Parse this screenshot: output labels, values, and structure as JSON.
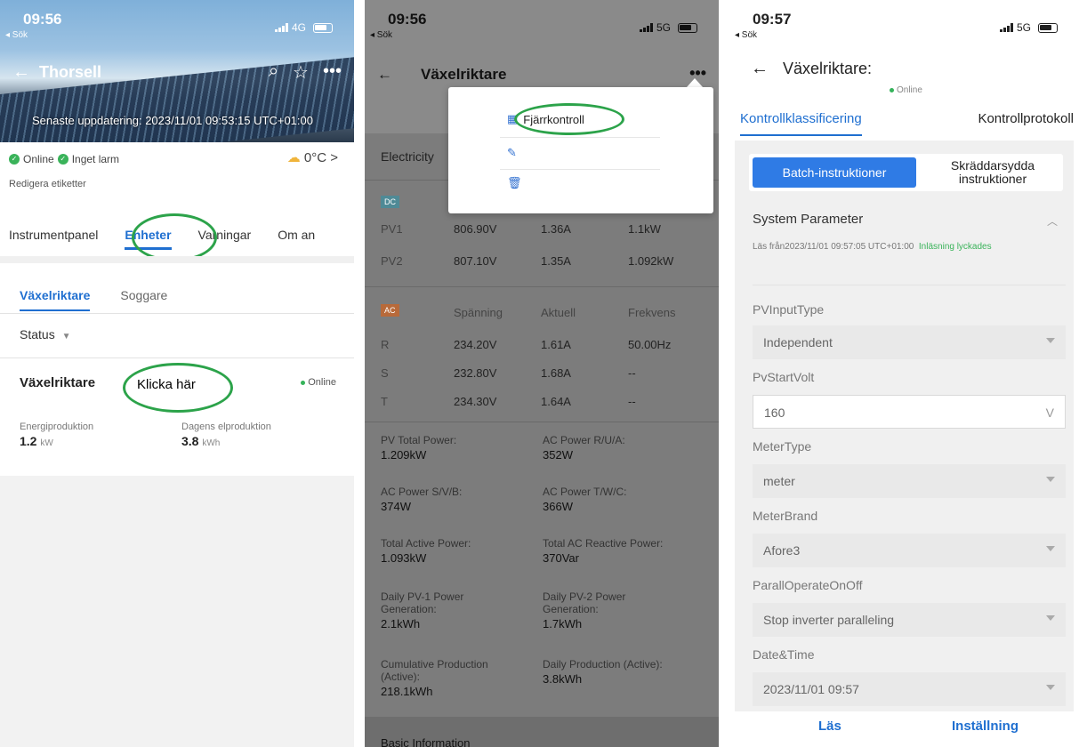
{
  "screen1": {
    "time": "09:56",
    "back": "◂ Sök",
    "network": "4G",
    "plant_name": "Thorsell",
    "last_update": "Senaste uppdatering: 2023/11/01 09:53:15 UTC+01:00",
    "status_online": "Online",
    "status_alarm": "Inget larm",
    "weather": "0°C >",
    "tags": "Redigera etiketter",
    "tabs": [
      "Instrumentpanel",
      "Enheter",
      "Varningar",
      "Om an"
    ],
    "subtabs": [
      "Växelriktare",
      "Soggare"
    ],
    "status_filter": "Status",
    "device_name": "Växelriktare",
    "click_label": "Klicka här",
    "device_status": "Online",
    "metrics": [
      {
        "label": "Energiproduktion",
        "value": "1.2",
        "unit": "kW"
      },
      {
        "label": "Dagens elproduktion",
        "value": "3.8",
        "unit": "kWh"
      }
    ],
    "highlight_color": "#2ca34a"
  },
  "screen2": {
    "time": "09:56",
    "back": "◂ Sök",
    "network": "5G",
    "title": "Växelriktare",
    "section": "Electricity",
    "menu": [
      "Fjärrkontroll",
      "",
      ""
    ],
    "dc_tag": "DC",
    "dc_rows": [
      [
        "PV1",
        "806.90V",
        "1.36A",
        "1.1kW"
      ],
      [
        "PV2",
        "807.10V",
        "1.35A",
        "1.092kW"
      ]
    ],
    "ac_tag": "AC",
    "ac_header": [
      "Spänning",
      "Aktuell",
      "Frekvens"
    ],
    "ac_rows": [
      [
        "R",
        "234.20V",
        "1.61A",
        "50.00Hz"
      ],
      [
        "S",
        "232.80V",
        "1.68A",
        "--"
      ],
      [
        "T",
        "234.30V",
        "1.64A",
        "--"
      ]
    ],
    "summary": [
      {
        "label": "PV Total Power:",
        "value": "1.209kW"
      },
      {
        "label": "AC Power R/U/A:",
        "value": "352W"
      },
      {
        "label": "AC Power S/V/B:",
        "value": "374W"
      },
      {
        "label": "AC Power T/W/C:",
        "value": "366W"
      },
      {
        "label": "Total Active Power:",
        "value": "1.093kW"
      },
      {
        "label": "Total AC Reactive Power:",
        "value": "370Var"
      },
      {
        "label": "Daily PV-1 Power Generation:",
        "value": "2.1kWh"
      },
      {
        "label": "Daily PV-2 Power Generation:",
        "value": "1.7kWh"
      },
      {
        "label": "Cumulative Production (Active):",
        "value": "218.1kWh"
      },
      {
        "label": "Daily Production (Active):",
        "value": "3.8kWh"
      }
    ],
    "footer": "Basic Information"
  },
  "screen3": {
    "time": "09:57",
    "back": "◂ Sök",
    "network": "5G",
    "title": "Växelriktare:",
    "online": "Online",
    "tabs": [
      "Kontrollklassificering",
      "Kontrollprotokoll"
    ],
    "segments": [
      "Batch-instruktioner",
      "Skräddarsydda instruktioner"
    ],
    "param_title": "System Parameter",
    "read_info_prefix": "Läs från2023/11/01 09:57:05 UTC+01:00",
    "read_info_status": "Inläsning lyckades",
    "params": [
      {
        "label": "PVInputType",
        "value": "Independent",
        "kind": "select"
      },
      {
        "label": "PvStartVolt",
        "value": "160",
        "unit": "V",
        "kind": "input"
      },
      {
        "label": "MeterType",
        "value": "meter",
        "kind": "select"
      },
      {
        "label": "MeterBrand",
        "value": "Afore3",
        "kind": "select"
      },
      {
        "label": "ParallOperateOnOff",
        "value": "Stop inverter paralleling",
        "kind": "select"
      },
      {
        "label": "Date&Time",
        "value": "2023/11/01 09:57",
        "kind": "select"
      }
    ],
    "actions": [
      "Läs",
      "Inställning"
    ],
    "accent_color": "#1f6fd0"
  }
}
